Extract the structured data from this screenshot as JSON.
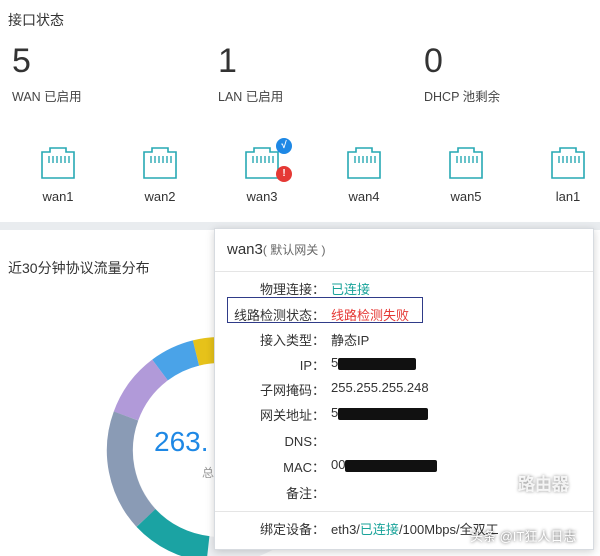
{
  "interface": {
    "title": "接口状态",
    "stats": [
      {
        "value": "5",
        "label": "WAN 已启用"
      },
      {
        "value": "1",
        "label": "LAN 已启用"
      },
      {
        "value": "0",
        "label": "DHCP 池剩余"
      }
    ],
    "ports": [
      {
        "name": "wan1"
      },
      {
        "name": "wan2"
      },
      {
        "name": "wan3",
        "ok_badge": "√",
        "err_badge": "!"
      },
      {
        "name": "wan4"
      },
      {
        "name": "wan5"
      },
      {
        "name": "lan1"
      }
    ]
  },
  "traffic": {
    "title": "近30分钟协议流量分布",
    "total": "263.",
    "total_sub": "总",
    "segments": [
      {
        "color": "#4aa3e8"
      },
      {
        "color": "#e6c21a"
      },
      {
        "color": "#b19ad9"
      },
      {
        "color": "#8a9bb5"
      },
      {
        "color": "#1ba3a3"
      }
    ]
  },
  "popup": {
    "title": "wan3",
    "subtitle": "( 默认网关 )",
    "rows": [
      {
        "key": "物理连接：",
        "value": "已连接"
      },
      {
        "key": "线路检测状态：",
        "value": "线路检测失败"
      },
      {
        "key": "接入类型：",
        "value": "静态IP"
      },
      {
        "key": "IP：",
        "value": "5"
      },
      {
        "key": "子网掩码：",
        "value": "255.255.255.248"
      },
      {
        "key": "网关地址：",
        "value": "5"
      },
      {
        "key": "DNS：",
        "value": ""
      },
      {
        "key": "MAC：",
        "value": "00"
      },
      {
        "key": "备注：",
        "value": ""
      }
    ],
    "bind": {
      "key": "绑定设备：",
      "prefix": "eth3/",
      "status": "已连接",
      "suffix": "/100Mbps/全双工"
    }
  },
  "watermark": {
    "logo": "路由器",
    "text": "头条 @IT狂人日志"
  },
  "colors": {
    "accent": "#1e88e5",
    "success": "#1aa39a",
    "error": "#e53935",
    "highlight_border": "#2f3b88"
  }
}
